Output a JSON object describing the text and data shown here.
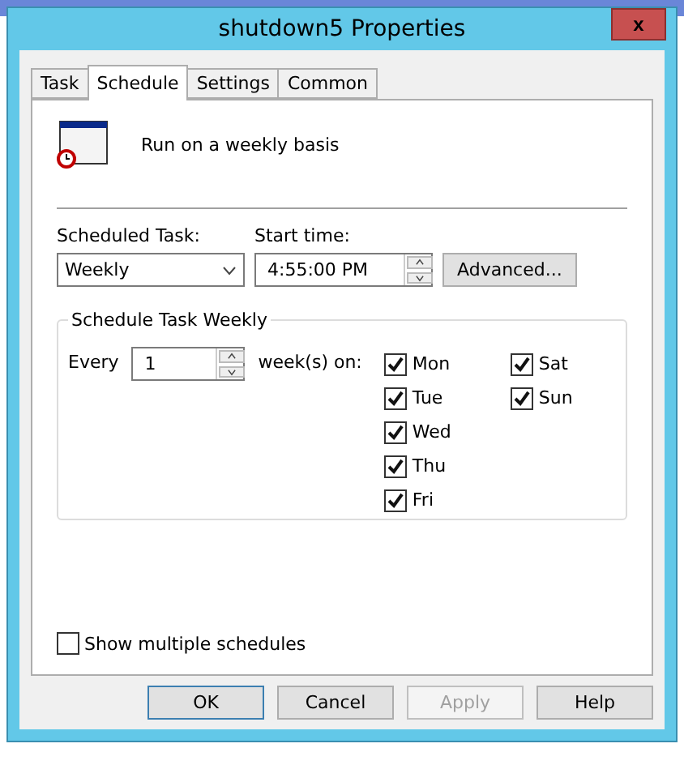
{
  "window": {
    "title": "shutdown5 Properties",
    "close": "x"
  },
  "tabs": [
    {
      "label": "Task",
      "selected": false
    },
    {
      "label": "Schedule",
      "selected": true
    },
    {
      "label": "Settings",
      "selected": false
    },
    {
      "label": "Common",
      "selected": false
    }
  ],
  "summary": "Run on a weekly basis",
  "scheduled_task": {
    "label": "Scheduled Task:",
    "value": "Weekly"
  },
  "start_time": {
    "label": "Start time:",
    "value": "4:55:00 PM"
  },
  "advanced_button": "Advanced...",
  "group": {
    "title": "Schedule Task Weekly",
    "every_label": "Every",
    "every_value": "1",
    "weeks_label": "week(s) on:",
    "days": [
      {
        "label": "Mon",
        "checked": true
      },
      {
        "label": "Tue",
        "checked": true
      },
      {
        "label": "Wed",
        "checked": true
      },
      {
        "label": "Thu",
        "checked": true
      },
      {
        "label": "Fri",
        "checked": true
      },
      {
        "label": "Sat",
        "checked": true
      },
      {
        "label": "Sun",
        "checked": true
      }
    ]
  },
  "show_multiple": {
    "label": "Show multiple schedules",
    "checked": false
  },
  "buttons": [
    {
      "label": "OK",
      "disabled": false,
      "default": true
    },
    {
      "label": "Cancel",
      "disabled": false,
      "default": false
    },
    {
      "label": "Apply",
      "disabled": true,
      "default": false
    },
    {
      "label": "Help",
      "disabled": false,
      "default": false
    }
  ]
}
